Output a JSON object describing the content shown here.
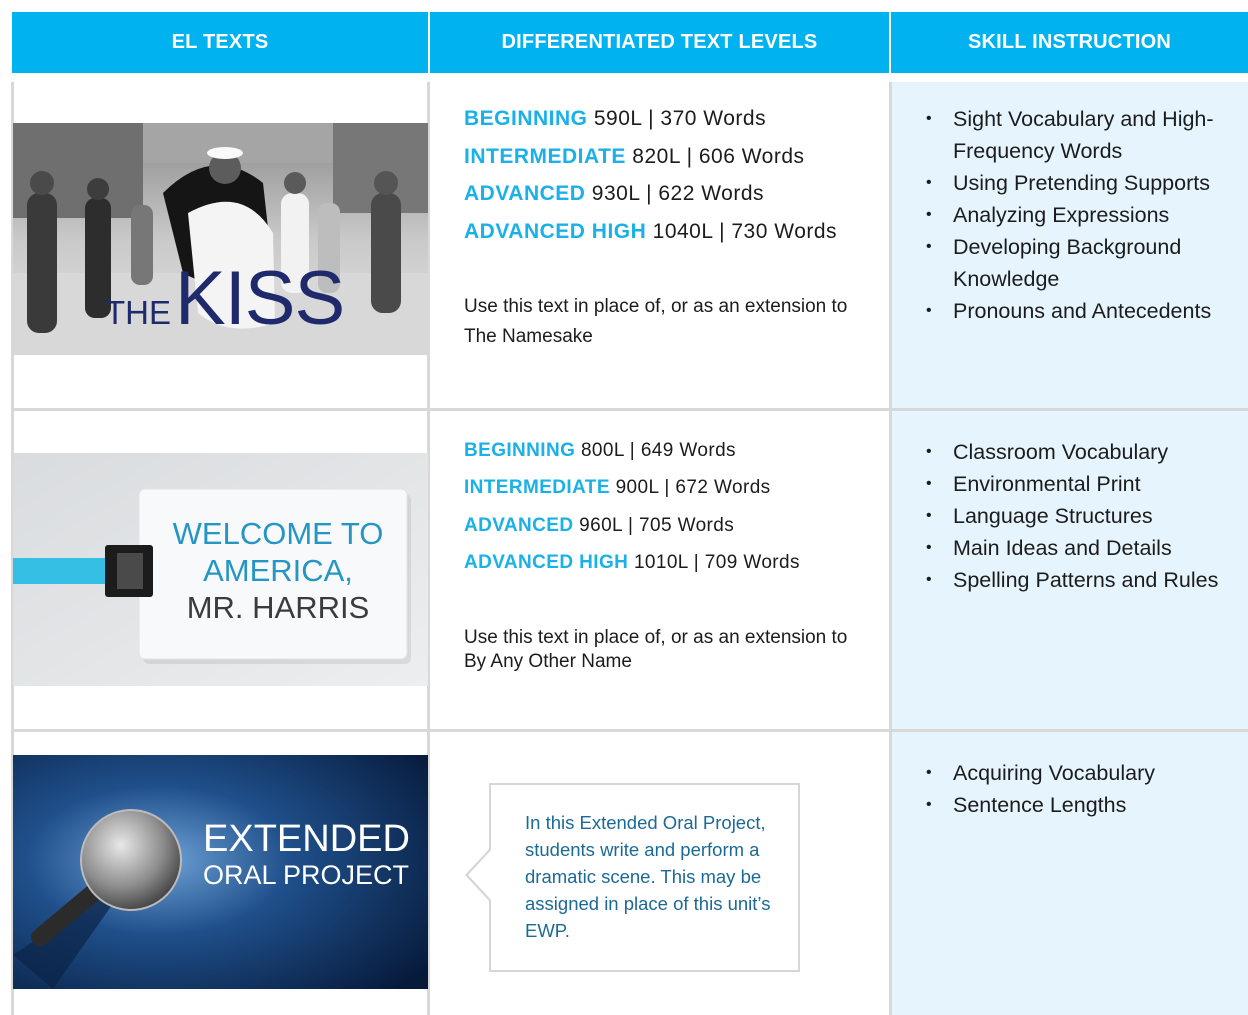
{
  "headers": {
    "el_texts": "EL TEXTS",
    "differentiated": "DIFFERENTIATED TEXT LEVELS",
    "skill_instruction": "SKILL INSTRUCTION"
  },
  "rows": [
    {
      "thumb": {
        "title_small": "THE",
        "title_large": "KISS"
      },
      "levels": [
        {
          "name": "BEGINNING",
          "detail": "590L | 370 Words"
        },
        {
          "name": "INTERMEDIATE",
          "detail": "820L | 606 Words"
        },
        {
          "name": "ADVANCED",
          "detail": "930L | 622 Words"
        },
        {
          "name": "ADVANCED HIGH",
          "detail": "1040L | 730 Words"
        }
      ],
      "note": "Use this text in place of, or as an extension to The Namesake",
      "skills": [
        "Sight Vocabulary and High-Frequency Words",
        "Using Pretending Supports",
        "Analyzing Expressions",
        "Developing Background Knowledge",
        "Pronouns and Antecedents"
      ]
    },
    {
      "thumb": {
        "line1": "WELCOME TO",
        "line2": "AMERICA,",
        "line3": "MR. HARRIS"
      },
      "levels": [
        {
          "name": "BEGINNING",
          "detail": "800L | 649 Words"
        },
        {
          "name": "INTERMEDIATE",
          "detail": "900L | 672 Words"
        },
        {
          "name": "ADVANCED",
          "detail": "960L | 705 Words"
        },
        {
          "name": "ADVANCED HIGH",
          "detail": "1010L | 709 Words"
        }
      ],
      "note": "Use this text in place of, or as an extension to By Any Other Name",
      "skills": [
        "Classroom Vocabulary",
        "Environmental Print",
        "Language Structures",
        "Main Ideas and Details",
        "Spelling Patterns and Rules"
      ]
    },
    {
      "thumb": {
        "line1": "EXTENDED",
        "line2": "ORAL PROJECT"
      },
      "callout": "In this Extended Oral Project, students write and perform a dramatic scene. This may be assigned in place of this unit’s EWP.",
      "skills": [
        "Acquiring Vocabulary",
        "Sentence Lengths"
      ]
    }
  ],
  "colors": {
    "header_bg": "#00b2ef",
    "level_name": "#1ab0e8",
    "skill_bg": "#e6f4fd",
    "callout_text": "#1b6a96"
  }
}
